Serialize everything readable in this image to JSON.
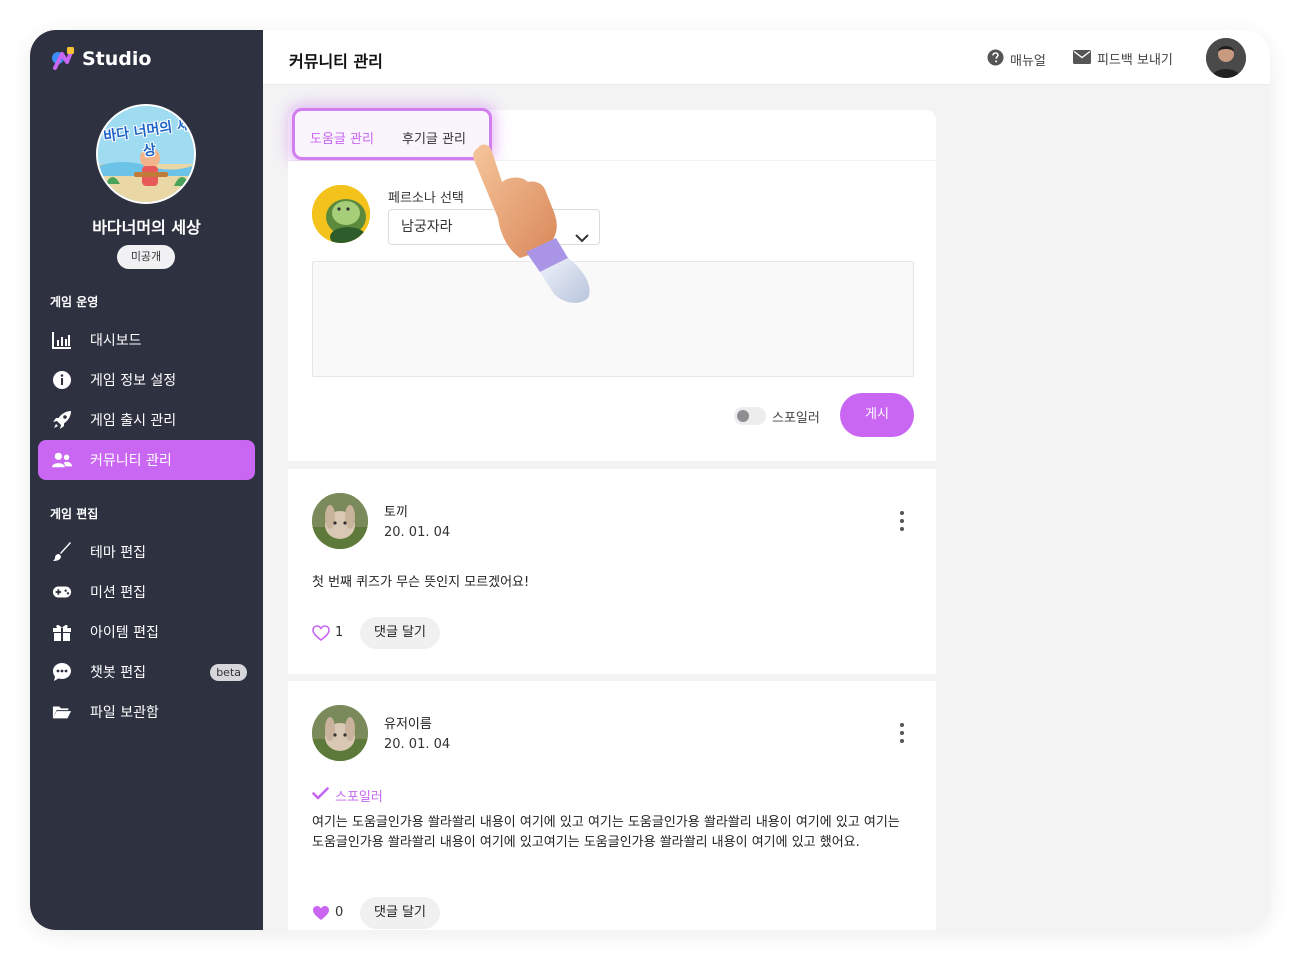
{
  "brand": {
    "name": "Studio"
  },
  "game": {
    "title": "바다너머의 세상",
    "visibility": "미공개",
    "logo_text": "바다 너머의 세상"
  },
  "sidebar": {
    "sections": [
      {
        "label": "게임 운영"
      },
      {
        "label": "게임 편집"
      }
    ],
    "items": [
      {
        "label": "대시보드",
        "icon": "bar-chart-icon"
      },
      {
        "label": "게임 정보 설정",
        "icon": "info-icon"
      },
      {
        "label": "게임 출시 관리",
        "icon": "rocket-icon"
      },
      {
        "label": "커뮤니티 관리",
        "icon": "users-icon",
        "active": true
      },
      {
        "label": "테마 편집",
        "icon": "brush-icon"
      },
      {
        "label": "미션 편집",
        "icon": "gamepad-icon"
      },
      {
        "label": "아이템 편집",
        "icon": "gift-icon"
      },
      {
        "label": "챗봇 편집",
        "icon": "chat-icon",
        "badge": "beta"
      },
      {
        "label": "파일 보관함",
        "icon": "folder-icon"
      }
    ]
  },
  "header": {
    "title": "커뮤니티 관리",
    "manual_label": "매뉴얼",
    "feedback_label": "피드백 보내기"
  },
  "tabs": [
    {
      "label": "도움글 관리",
      "active": true
    },
    {
      "label": "후기글 관리",
      "active": false
    }
  ],
  "composer": {
    "persona_label": "페르소나 선택",
    "persona_value": "남궁자라",
    "spoiler_label": "스포일러",
    "spoiler_on": false,
    "post_label": "게시"
  },
  "posts": [
    {
      "author": "토끼",
      "date": "20. 01. 04",
      "spoiler": false,
      "spoiler_label": "",
      "body": "첫 번째 퀴즈가 무슨 뜻인지 모르겠어요!",
      "likes": "1",
      "liked": false,
      "reply_label": "댓글 달기"
    },
    {
      "author": "유저이름",
      "date": "20. 01. 04",
      "spoiler": true,
      "spoiler_label": "스포일러",
      "body": "여기는 도움글인가용 쏼라쏼리 내용이 여기에 있고 여기는 도움글인가용 쏼라쏼리 내용이 여기에 있고 여기는 도움글인가용 쏼라쏼리 내용이 여기에 있고여기는 도움글인가용 쏼라쏼리 내용이 여기에 있고 했어요.",
      "likes": "0",
      "liked": true,
      "reply_label": "댓글 달기"
    }
  ],
  "colors": {
    "accent": "#c966f2",
    "sidebar_bg": "#2d3140",
    "spoiler_tag": "#c466ee"
  }
}
